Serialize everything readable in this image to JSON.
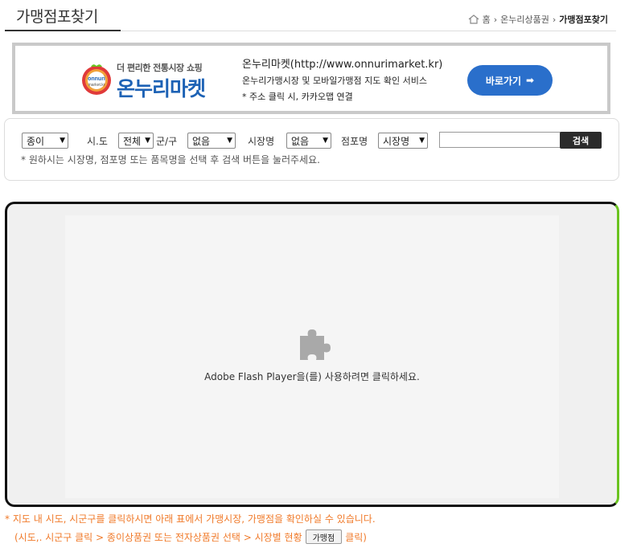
{
  "header": {
    "title": "가맹점포찾기",
    "breadcrumb": [
      "홈",
      "온누리상품권",
      "가맹점포찾기"
    ]
  },
  "banner": {
    "logo_tagline": "더 편리한 전통시장 쇼핑",
    "logo_name": "온누리마켓",
    "logo_mark_text": "onnuri market.kr",
    "site_line": "온누리마켓(http://www.onnurimarket.kr)",
    "desc_line": "온누리가맹시장 및 모바일가맹점 지도 확인 서비스",
    "note_line": "* 주소 클릭 시, 카카오맵 연결",
    "go_label": "바로가기"
  },
  "search": {
    "type_value": "종이",
    "sido_label": "시.도",
    "sido_value": "전체",
    "gungu_label": "군/구",
    "gungu_value": "없음",
    "market_label": "시장명",
    "market_value": "없음",
    "store_label": "점포명",
    "store_value": "시장명",
    "query_value": "",
    "button_label": "검색",
    "hint": "* 원하시는 시장명, 점포명 또는 품목명을 선택 후 검색 버튼을 눌러주세요."
  },
  "flash": {
    "message": "Adobe Flash Player을(를) 사용하려면 클릭하세요."
  },
  "notes": {
    "line1": "* 지도 내 시도, 시군구를 클릭하시면 아래 표에서 가맹시장, 가맹점을 확인하실 수 있습니다.",
    "line2_pre": "(시도,. 시군구 클릭 > 종이상품권 또는 전자상품권 선택 > 시장별 현황",
    "line2_button": "가맹점",
    "line2_post": "클릭)"
  },
  "colors": {
    "accent_blue": "#2a6fcb",
    "accent_green": "#6ac31f",
    "note_orange": "#f07a2a"
  }
}
